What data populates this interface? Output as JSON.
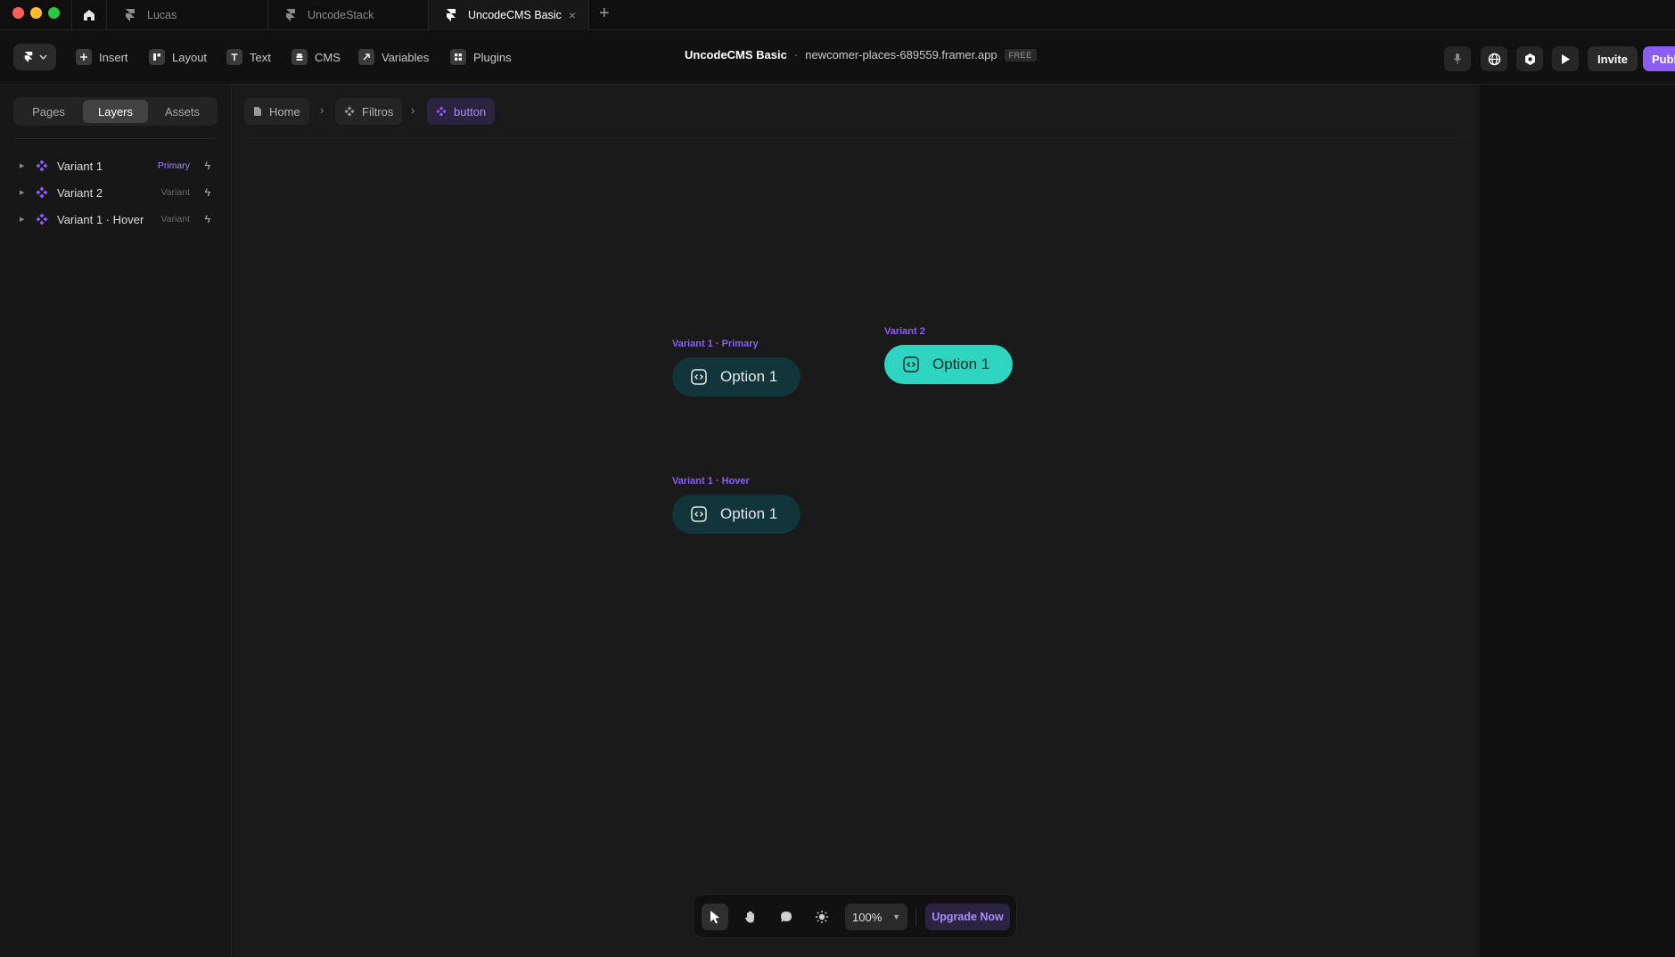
{
  "tabs": [
    {
      "label": "Lucas",
      "active": false
    },
    {
      "label": "UncodeStack",
      "active": false
    },
    {
      "label": "UncodeCMS Basic",
      "active": true
    }
  ],
  "toolbar": {
    "tools": [
      {
        "label": "Insert",
        "icon": "plus-icon"
      },
      {
        "label": "Layout",
        "icon": "layout-icon"
      },
      {
        "label": "Text",
        "icon": "text-icon"
      },
      {
        "label": "CMS",
        "icon": "database-icon"
      },
      {
        "label": "Variables",
        "icon": "arrow-icon"
      },
      {
        "label": "Plugins",
        "icon": "plugins-icon"
      }
    ],
    "project_name": "UncodeCMS Basic",
    "separator": "·",
    "domain": "newcomer-places-689559.framer.app",
    "plan_badge": "FREE",
    "invite_label": "Invite",
    "publish_label": "Publish"
  },
  "sidebar": {
    "segments": [
      "Pages",
      "Layers",
      "Assets"
    ],
    "active_segment": "Layers",
    "layers": [
      {
        "name": "Variant 1",
        "tag": "Primary"
      },
      {
        "name": "Variant 2",
        "tag": "Variant"
      },
      {
        "name": "Variant 1 · Hover",
        "tag": "Variant"
      }
    ]
  },
  "breadcrumb": [
    {
      "label": "Home",
      "icon": "page-icon"
    },
    {
      "label": "Filtros",
      "icon": "component-icon"
    },
    {
      "label": "button",
      "icon": "component-icon"
    }
  ],
  "canvas": {
    "variants": [
      {
        "label": "Variant 1 · Primary",
        "button_text": "Option 1"
      },
      {
        "label": "Variant 2",
        "button_text": "Option 1"
      },
      {
        "label": "Variant 1 · Hover",
        "button_text": "Option 1"
      }
    ]
  },
  "bottom_toolbar": {
    "zoom": "100%",
    "upgrade_label": "Upgrade Now"
  },
  "colors": {
    "accent": "#8b5cf6",
    "button_dark": "#11353a",
    "button_light": "#2dd4bf"
  }
}
